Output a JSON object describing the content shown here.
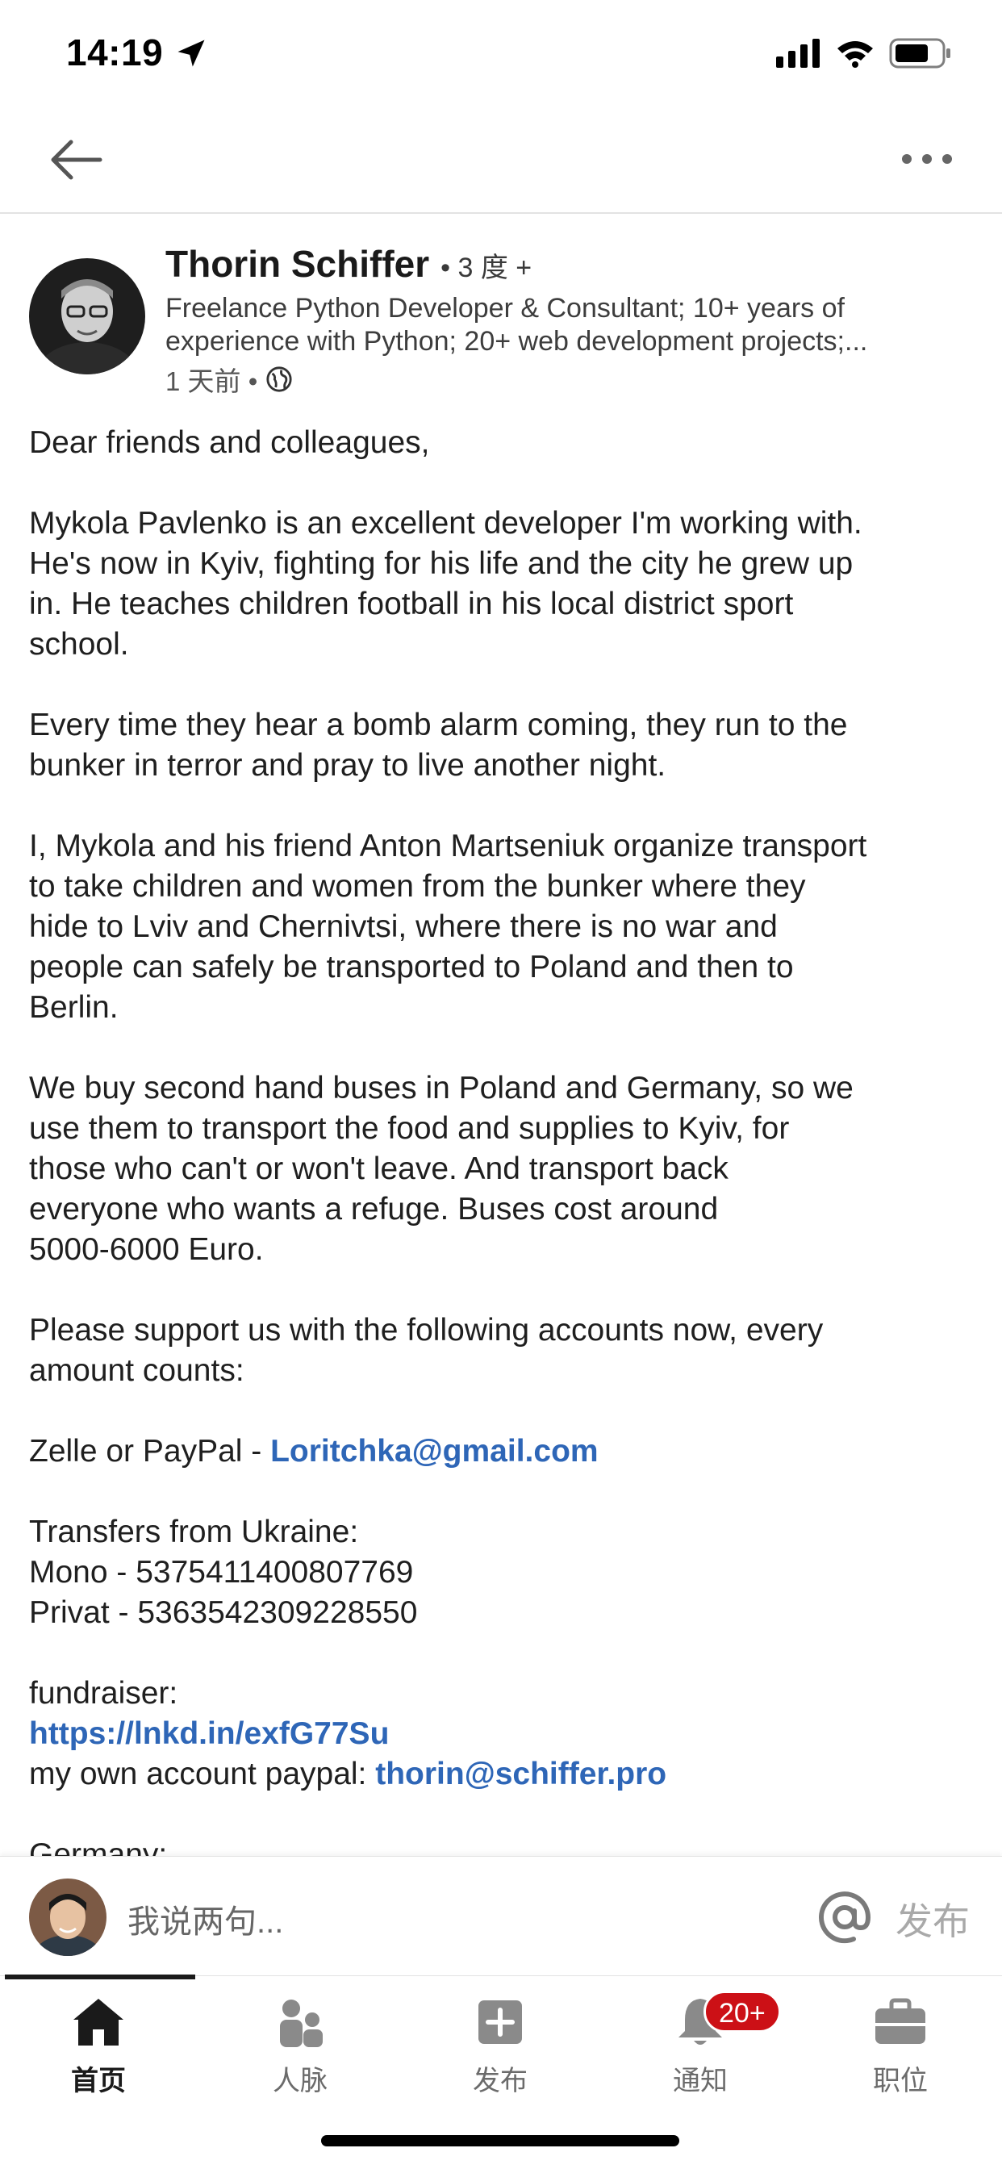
{
  "status_bar": {
    "time": "14:19"
  },
  "header": {
    "back_icon": "arrow-left-icon",
    "more_icon": "ellipsis-icon"
  },
  "author": {
    "name": "Thorin Schiffer",
    "degree": "• 3 度 +",
    "headline_line1": "Freelance Python Developer & Consultant; 10+ years of",
    "headline_line2": "experience with Python; 20+ web development projects;...",
    "time": "1 天前 •"
  },
  "post": {
    "greeting": "Dear friends and colleagues,",
    "p1": [
      "Mykola Pavlenko is an excellent developer I'm working with.",
      "He's now in Kyiv, fighting for his life and the city he grew up",
      "in. He teaches children football in his local district sport",
      "school."
    ],
    "p2": [
      "Every time they hear a bomb alarm coming, they run to the",
      "bunker in terror and pray to live another night."
    ],
    "p3": [
      "I, Mykola and his friend Anton Martseniuk organize transport",
      "to take children and women from the bunker where they",
      "hide to Lviv and Chernivtsi, where there is no war and",
      "people can safely be transported to Poland and then to",
      "Berlin."
    ],
    "p4": [
      "We buy second hand buses in Poland and Germany, so we",
      "use them to transport the food and supplies to Kyiv, for",
      "those who can't or won't leave. And transport back",
      "everyone who wants a refuge. Buses cost around",
      "5000-6000 Euro."
    ],
    "p5": [
      "Please support us with the following accounts now, every",
      "amount counts:"
    ],
    "zelle_prefix": "Zelle or PayPal - ",
    "zelle_email": "Loritchka@gmail.com",
    "transfers_title": "Transfers from Ukraine:",
    "mono": "Mono - 5375411400807769",
    "privat": "Privat - 5363542309228550",
    "fundraiser_label": "fundraiser:",
    "fundraiser_link": "https://lnkd.in/exfG77Su",
    "own_paypal_prefix": "my own account paypal: ",
    "own_paypal_email": "thorin@schiffer.pro",
    "cutoff_line": "Germany:"
  },
  "comment_bar": {
    "placeholder": "我说两句...",
    "publish_label": "发布",
    "mention_icon": "at-icon"
  },
  "bottom_nav": {
    "items": [
      {
        "label": "首页",
        "icon": "home-icon",
        "active": true
      },
      {
        "label": "人脉",
        "icon": "people-icon"
      },
      {
        "label": "发布",
        "icon": "plus-square-icon"
      },
      {
        "label": "通知",
        "icon": "bell-icon",
        "badge": "20+"
      },
      {
        "label": "职位",
        "icon": "briefcase-icon"
      }
    ]
  },
  "colors": {
    "link": "#2e66b7",
    "badge": "#cc1016",
    "text": "#1f1f1f"
  }
}
